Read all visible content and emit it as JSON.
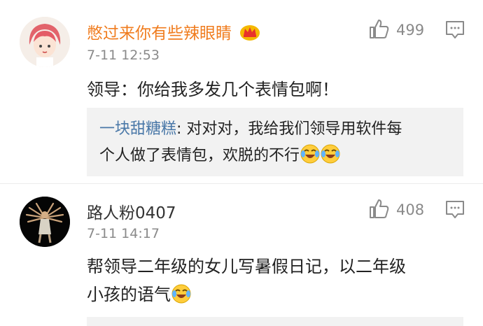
{
  "comments": [
    {
      "username": "憋过来你有些辣眼睛",
      "username_color": "#f07c1e",
      "time": "7-11 12:53",
      "likes": "499",
      "text": "领导：你给我多发几个表情包啊！",
      "reply": {
        "name": "一块甜糖糕",
        "separator": ":",
        "text_line1": " 对对对，我给我们领导用软件每",
        "text_line2": "个人做了表情包，欢脱的不行"
      }
    },
    {
      "username": "路人粉0407",
      "username_color": "#333333",
      "time": "7-11 14:17",
      "likes": "408",
      "text_line1": "帮领导二年级的女儿写暑假日记，以二年级",
      "text_line2": "小孩的语气"
    }
  ],
  "icons": {
    "crown": "crown-badge-icon",
    "like": "thumbs-up-icon",
    "comment": "comment-icon",
    "emoji": "laugh-cry-emoji-icon"
  }
}
